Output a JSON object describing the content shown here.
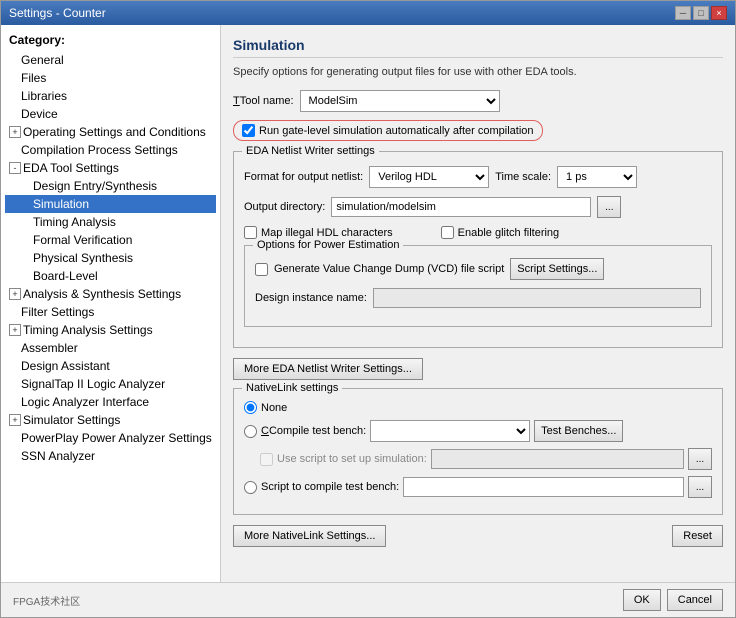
{
  "window": {
    "title": "Settings - Counter",
    "close_btn": "×",
    "min_btn": "─",
    "max_btn": "□"
  },
  "sidebar": {
    "category_label": "Category:",
    "items": [
      {
        "id": "general",
        "label": "General",
        "indent": 1,
        "expander": null
      },
      {
        "id": "files",
        "label": "Files",
        "indent": 1,
        "expander": null
      },
      {
        "id": "libraries",
        "label": "Libraries",
        "indent": 1,
        "expander": null
      },
      {
        "id": "device",
        "label": "Device",
        "indent": 1,
        "expander": null
      },
      {
        "id": "operating",
        "label": "Operating Settings and Conditions",
        "indent": 1,
        "expander": "+"
      },
      {
        "id": "compilation",
        "label": "Compilation Process Settings",
        "indent": 1,
        "expander": null
      },
      {
        "id": "eda-tool",
        "label": "EDA Tool Settings",
        "indent": 1,
        "expander": "-"
      },
      {
        "id": "design-entry",
        "label": "Design Entry/Synthesis",
        "indent": 2,
        "expander": null
      },
      {
        "id": "simulation",
        "label": "Simulation",
        "indent": 2,
        "expander": null,
        "selected": true
      },
      {
        "id": "timing-analysis",
        "label": "Timing Analysis",
        "indent": 2,
        "expander": null
      },
      {
        "id": "formal-verification",
        "label": "Formal Verification",
        "indent": 2,
        "expander": null
      },
      {
        "id": "physical-synthesis",
        "label": "Physical Synthesis",
        "indent": 2,
        "expander": null
      },
      {
        "id": "board-level",
        "label": "Board-Level",
        "indent": 2,
        "expander": null
      },
      {
        "id": "analysis-synthesis",
        "label": "Analysis & Synthesis Settings",
        "indent": 1,
        "expander": "+"
      },
      {
        "id": "filter-settings",
        "label": "Filter Settings",
        "indent": 1,
        "expander": null
      },
      {
        "id": "timing-analysis-settings",
        "label": "Timing Analysis Settings",
        "indent": 1,
        "expander": "+"
      },
      {
        "id": "assembler",
        "label": "Assembler",
        "indent": 1,
        "expander": null
      },
      {
        "id": "design-assistant",
        "label": "Design Assistant",
        "indent": 1,
        "expander": null
      },
      {
        "id": "signaltap",
        "label": "SignalTap II Logic Analyzer",
        "indent": 1,
        "expander": null
      },
      {
        "id": "logic-analyzer",
        "label": "Logic Analyzer Interface",
        "indent": 1,
        "expander": null
      },
      {
        "id": "simulator",
        "label": "Simulator Settings",
        "indent": 1,
        "expander": "+"
      },
      {
        "id": "powerplay",
        "label": "PowerPlay Power Analyzer Settings",
        "indent": 1,
        "expander": null
      },
      {
        "id": "ssn",
        "label": "SSN Analyzer",
        "indent": 1,
        "expander": null
      }
    ]
  },
  "main": {
    "section_title": "Simulation",
    "description": "Specify options for generating output files for use with other EDA tools.",
    "tool_name_label": "Tool name:",
    "tool_name_value": "ModelSim",
    "run_gate_label": "Run gate-level simulation automatically after compilation",
    "eda_netlist_group": "EDA Netlist Writer settings",
    "format_label": "Format for output netlist:",
    "format_value": "Verilog HDL",
    "timescale_label": "Time scale:",
    "timescale_value": "1 ps",
    "output_dir_label": "Output directory:",
    "output_dir_value": "simulation/modelsim",
    "map_illegal_label": "Map illegal HDL characters",
    "enable_glitch_label": "Enable glitch filtering",
    "power_estimation_group": "Options for Power Estimation",
    "generate_vcd_label": "Generate Value Change Dump (VCD) file script",
    "script_settings_btn": "Script Settings...",
    "design_instance_label": "Design instance name:",
    "more_eda_btn": "More EDA Netlist Writer Settings...",
    "nativelink_group": "NativeLink settings",
    "none_label": "None",
    "compile_bench_label": "Compile test bench:",
    "use_script_label": "Use script to set up simulation:",
    "script_compile_label": "Script to compile test bench:",
    "more_nativelink_btn": "More NativeLink Settings...",
    "reset_btn": "Reset",
    "ok_btn": "OK",
    "cancel_btn": "Cancel"
  }
}
